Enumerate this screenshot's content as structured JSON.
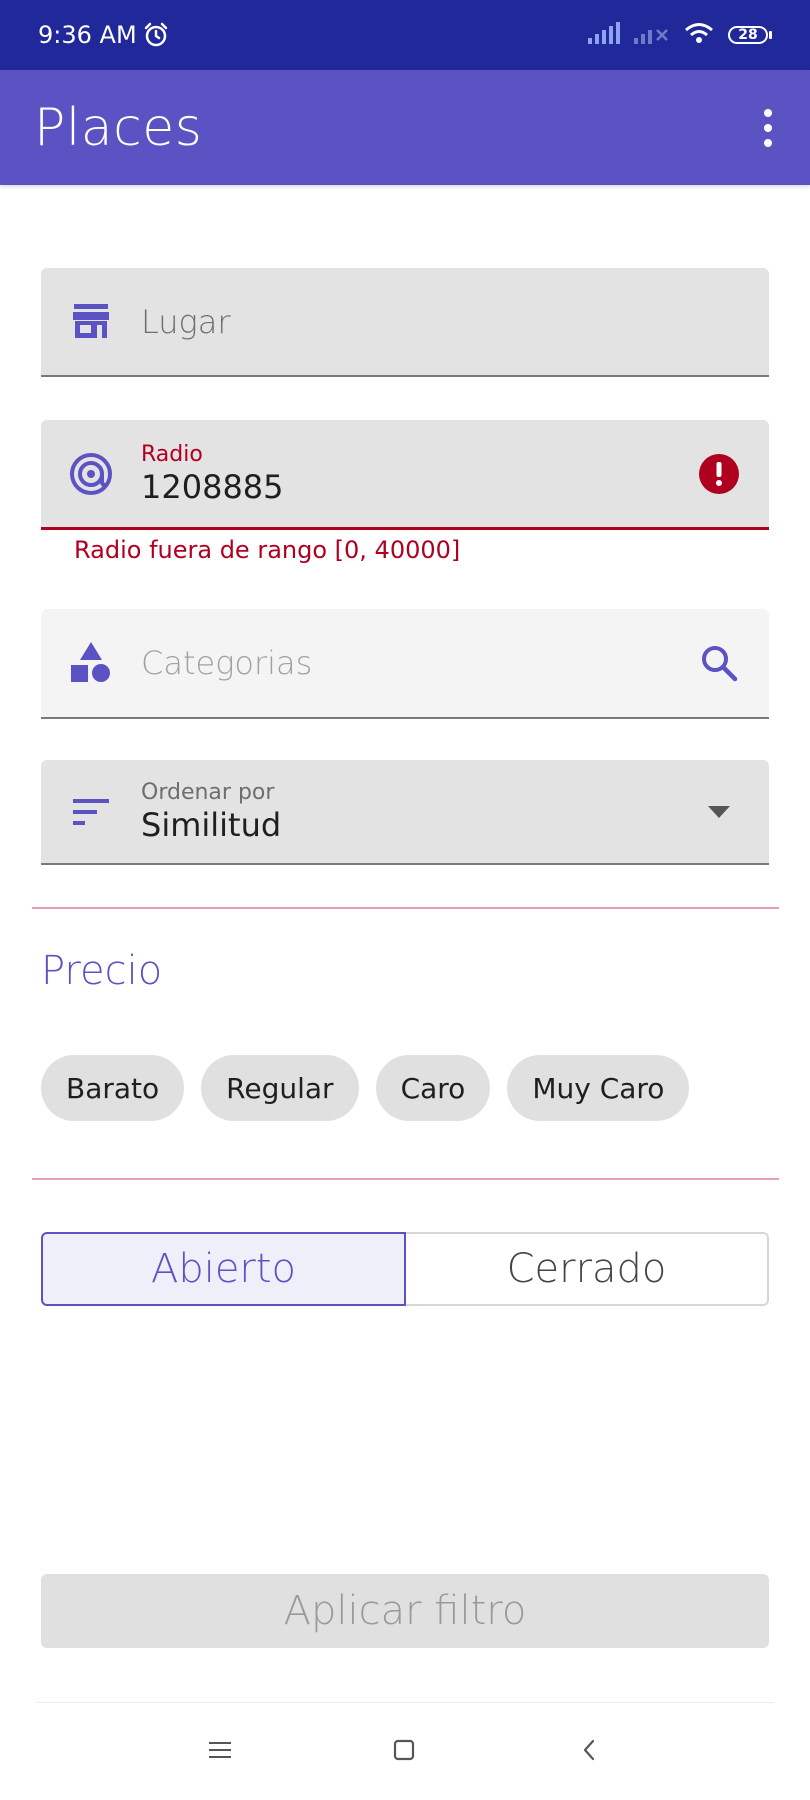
{
  "status_bar": {
    "time": "9:36 AM",
    "battery": "28",
    "icons": [
      "alarm-icon",
      "signal-icon",
      "signal-x-icon",
      "wifi-icon",
      "battery-icon"
    ]
  },
  "app_bar": {
    "title": "Places",
    "menu_icon": "more-vert-icon"
  },
  "form": {
    "lugar": {
      "placeholder": "Lugar",
      "icon": "store-icon"
    },
    "radio": {
      "label": "Radio",
      "value": "1208885",
      "error": "Radio fuera de rango [0, 40000]",
      "icon": "radar-icon",
      "error_icon": "error-icon"
    },
    "categorias": {
      "placeholder": "Categorias",
      "icon": "category-shapes-icon",
      "trailing_icon": "search-icon"
    },
    "ordenar": {
      "label": "Ordenar por",
      "value": "Similitud",
      "icon": "sort-icon",
      "trailing_icon": "dropdown-arrow-icon"
    }
  },
  "precio": {
    "title": "Precio",
    "chips": [
      "Barato",
      "Regular",
      "Caro",
      "Muy Caro"
    ]
  },
  "estado": {
    "options": [
      "Abierto",
      "Cerrado"
    ],
    "selected": "Abierto"
  },
  "apply_button": {
    "label": "Aplicar filtro"
  },
  "nav_bar": {
    "icons": [
      "menu-icon",
      "home-square-icon",
      "back-icon"
    ]
  },
  "colors": {
    "status_bar": "#21289a",
    "primary": "#5b53c4",
    "error": "#b00020",
    "divider": "#e5a0b4"
  }
}
